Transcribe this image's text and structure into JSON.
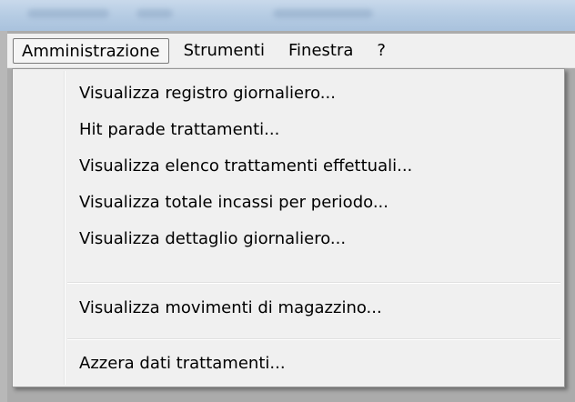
{
  "menubar": {
    "items": [
      {
        "label": "Amministrazione",
        "open": true
      },
      {
        "label": "Strumenti"
      },
      {
        "label": "Finestra"
      },
      {
        "label": "?"
      }
    ]
  },
  "dropdown": {
    "items": [
      {
        "label": "Visualizza registro giornaliero..."
      },
      {
        "label": "Hit parade trattamenti..."
      },
      {
        "label": "Visualizza elenco trattamenti effettuali..."
      },
      {
        "label": "Visualizza totale incassi per periodo..."
      },
      {
        "label": "Visualizza dettaglio giornaliero..."
      },
      {
        "label": "Visualizza movimenti di magazzino..."
      },
      {
        "label": "Azzera dati trattamenti..."
      }
    ]
  },
  "colors": {
    "menu_background": "#f0f0f0",
    "titlebar": "#b7cde4",
    "desktop": "#ababab"
  }
}
